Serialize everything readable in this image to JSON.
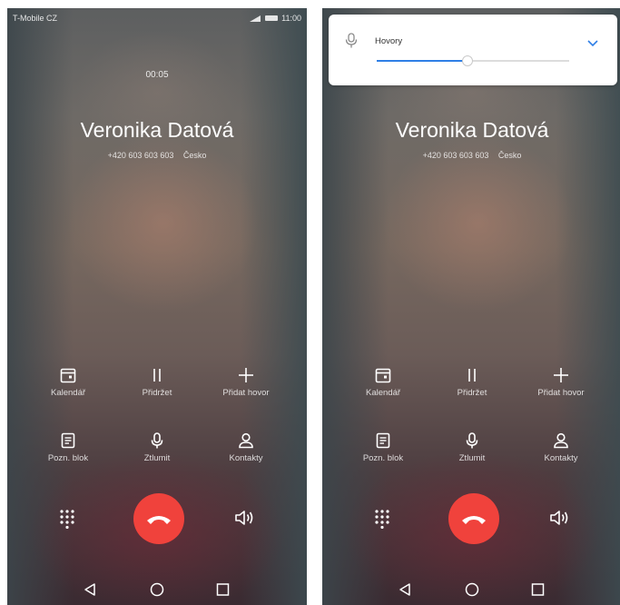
{
  "status": {
    "carrier": "T-Mobile CZ",
    "time": "11:00"
  },
  "call": {
    "timer": "00:05",
    "name": "Veronika Datová",
    "number": "+420 603 603 603",
    "country": "Česko"
  },
  "buttons": {
    "calendar": "Kalendář",
    "hold": "Přidržet",
    "add_call": "Přidat hovor",
    "notes": "Pozn. blok",
    "mute": "Ztlumit",
    "contacts": "Kontakty"
  },
  "volume": {
    "label": "Hovory",
    "level_fraction": 0.47,
    "accent": "#2f7fe6"
  },
  "colors": {
    "end_call": "#f0423c"
  },
  "icons": [
    "calendar-icon",
    "pause-icon",
    "plus-icon",
    "notepad-icon",
    "microphone-icon",
    "person-icon",
    "dialpad-icon",
    "end-call-icon",
    "speaker-icon",
    "back-icon",
    "home-icon",
    "recents-icon",
    "chevron-down-icon"
  ]
}
